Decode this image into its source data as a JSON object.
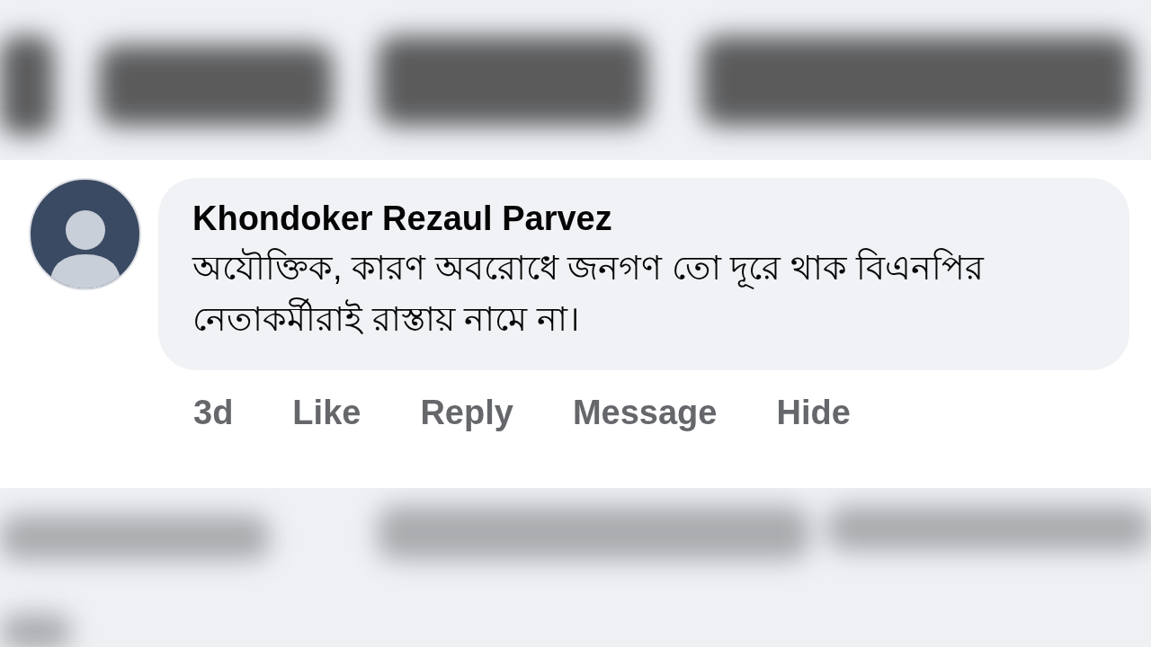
{
  "comment": {
    "author": "Khondoker Rezaul Parvez",
    "text": "অযৌক্তিক, কারণ অবরোধে জনগণ তো দূরে থাক বিএনপির নেতাকর্মীরাই রাস্তায় নামে না।",
    "time": "3d",
    "actions": [
      "Like",
      "Reply",
      "Message",
      "Hide"
    ]
  }
}
